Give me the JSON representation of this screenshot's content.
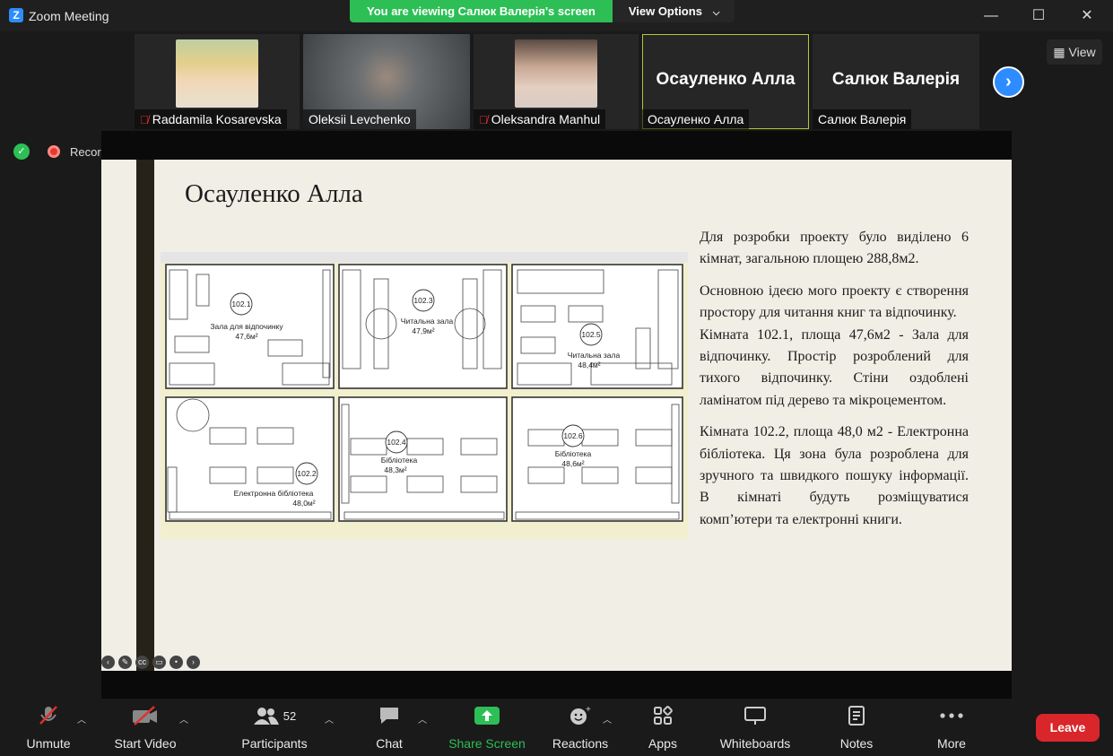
{
  "window": {
    "title": "Zoom Meeting",
    "logo_letter": "Z",
    "controls": {
      "minimize": "—",
      "maximize": "☐",
      "close": "✕"
    }
  },
  "share_banner": {
    "viewing_text": "You are viewing Салюк Валерія's screen",
    "view_options_label": "View Options"
  },
  "participants": [
    {
      "name": "Raddamila Kosarevska",
      "muted": true,
      "type": "photo",
      "photo_color": "#d9c58a"
    },
    {
      "name": "Oleksii Levchenko",
      "muted": false,
      "type": "photo",
      "photo_color": "#6b6e70"
    },
    {
      "name": "Oleksandra Manhul",
      "muted": true,
      "type": "photo",
      "photo_color": "#b49a8a"
    },
    {
      "name": "Осауленко Алла",
      "muted": false,
      "type": "name",
      "display_name": "Осауленко Алла",
      "active": true
    },
    {
      "name": "Салюк Валерія",
      "muted": false,
      "type": "name",
      "display_name": "Салюк Валерія"
    }
  ],
  "view_button": {
    "label": "View"
  },
  "status": {
    "recording_label": "Recording"
  },
  "slide": {
    "title": "Осауленко Алла",
    "paragraphs": [
      "Для розробки проекту було виділено 6 кімнат, загальною площею 288,8м2.",
      "Основною ідеєю мого проекту є створення простору для читання книг та відпочинку.",
      "Кімната 102.1, площа 47,6м2 - Зала для відпочинку. Простір розроблений для тихого відпочинку. Стіни оздоблені ламінатом під дерево та мікроцементом.",
      "Кімната 102.2, площа 48,0 м2 - Електронна бібліотека. Ця зона була розроблена для зручного та швидкого пошуку інформації. В кімнаті будуть розміщуватися комп’ютери та електронні книги."
    ],
    "rooms": [
      {
        "number": "102.1",
        "name": "Зала для відпочинку",
        "area": "47,6м²"
      },
      {
        "number": "102.3",
        "name": "Читальна зала",
        "area": "47,9м²"
      },
      {
        "number": "102.5",
        "name": "Читальна зала",
        "area": "48,4м²"
      },
      {
        "number": "102.2",
        "name": "Електронна бібліотека",
        "area": "48,0м²"
      },
      {
        "number": "102.4",
        "name": "Бібліотека",
        "area": "48,3м²"
      },
      {
        "number": "102.6",
        "name": "Бібліотека",
        "area": "48,6м²"
      }
    ]
  },
  "toolbar": {
    "unmute": "Unmute",
    "start_video": "Start Video",
    "participants": "Participants",
    "participants_count": "52",
    "chat": "Chat",
    "share_screen": "Share Screen",
    "reactions": "Reactions",
    "apps": "Apps",
    "whiteboards": "Whiteboards",
    "notes": "Notes",
    "more": "More",
    "leave": "Leave"
  },
  "colors": {
    "accent_blue": "#2d8cff",
    "share_green": "#2dbf55",
    "leave_red": "#d9262a",
    "active_outline": "#b6c63b"
  }
}
